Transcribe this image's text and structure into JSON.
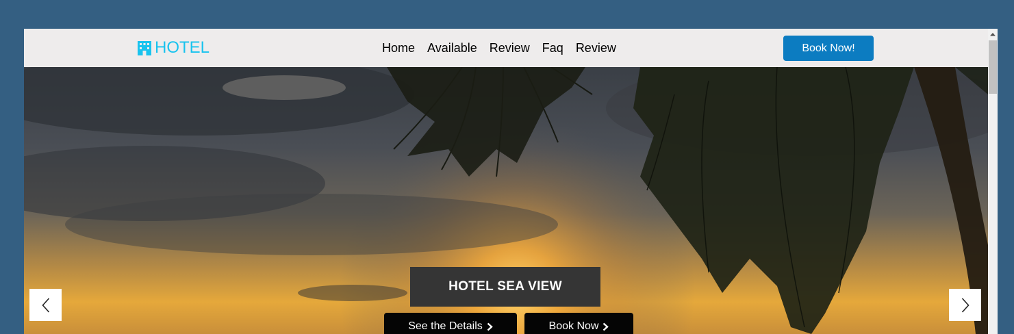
{
  "brand": {
    "name": "HOTEL",
    "icon": "hotel-building-icon",
    "color": "#19c3ee"
  },
  "nav": {
    "links": [
      {
        "label": "Home"
      },
      {
        "label": "Available"
      },
      {
        "label": "Review"
      },
      {
        "label": "Faq"
      },
      {
        "label": "Review"
      }
    ],
    "book_label": "Book Now!",
    "book_color": "#0c7cc1"
  },
  "hero": {
    "title": "HOTEL SEA VIEW",
    "details_label": "See the Details",
    "book_label": "Book Now",
    "button_icon": "chevron-right-icon",
    "prev_icon": "chevron-left-icon",
    "next_icon": "chevron-right-icon"
  },
  "colors": {
    "page_background": "#345f82",
    "navbar_background": "#eeecec",
    "caption_background": "#353535"
  }
}
